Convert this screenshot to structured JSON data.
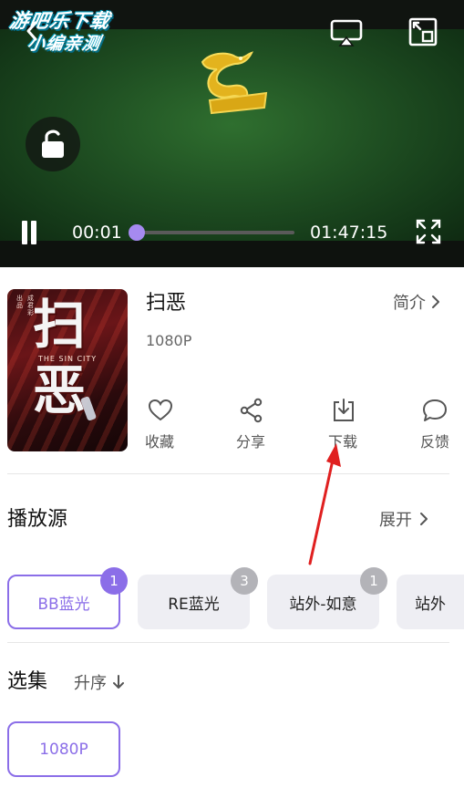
{
  "watermark": {
    "line1": "游吧乐下载",
    "line2": "小编亲测"
  },
  "player": {
    "current_time": "00:01",
    "total_time": "01:47:15",
    "progress_fraction": 0.0,
    "accent_color": "#a68af0"
  },
  "movie": {
    "title": "扫恶",
    "quality": "1080P",
    "intro_label": "简介",
    "poster": {
      "big_char_1": "扫",
      "big_char_2": "恶",
      "subtitle": "THE SIN CITY",
      "small_text_1": "出品",
      "small_text_2": "成君彩"
    }
  },
  "actions": [
    {
      "label": "收藏",
      "icon": "heart-icon"
    },
    {
      "label": "分享",
      "icon": "share-icon"
    },
    {
      "label": "下载",
      "icon": "download-icon"
    },
    {
      "label": "反馈",
      "icon": "feedback-icon"
    }
  ],
  "sources": {
    "title": "播放源",
    "expand_label": "展开",
    "items": [
      {
        "label": "BB蓝光",
        "badge": "1",
        "active": true
      },
      {
        "label": "RE蓝光",
        "badge": "3",
        "active": false
      },
      {
        "label": "站外-如意",
        "badge": "1",
        "active": false
      },
      {
        "label": "站外",
        "badge": "",
        "active": false
      }
    ]
  },
  "episodes": {
    "title": "选集",
    "sort_label": "升序",
    "items": [
      {
        "label": "1080P",
        "active": true
      }
    ]
  },
  "colors": {
    "accent": "#8b6ee8",
    "badge_inactive": "#b3b3b8",
    "chip_inactive_bg": "#eeeef3",
    "annotation_arrow": "#e02020"
  }
}
